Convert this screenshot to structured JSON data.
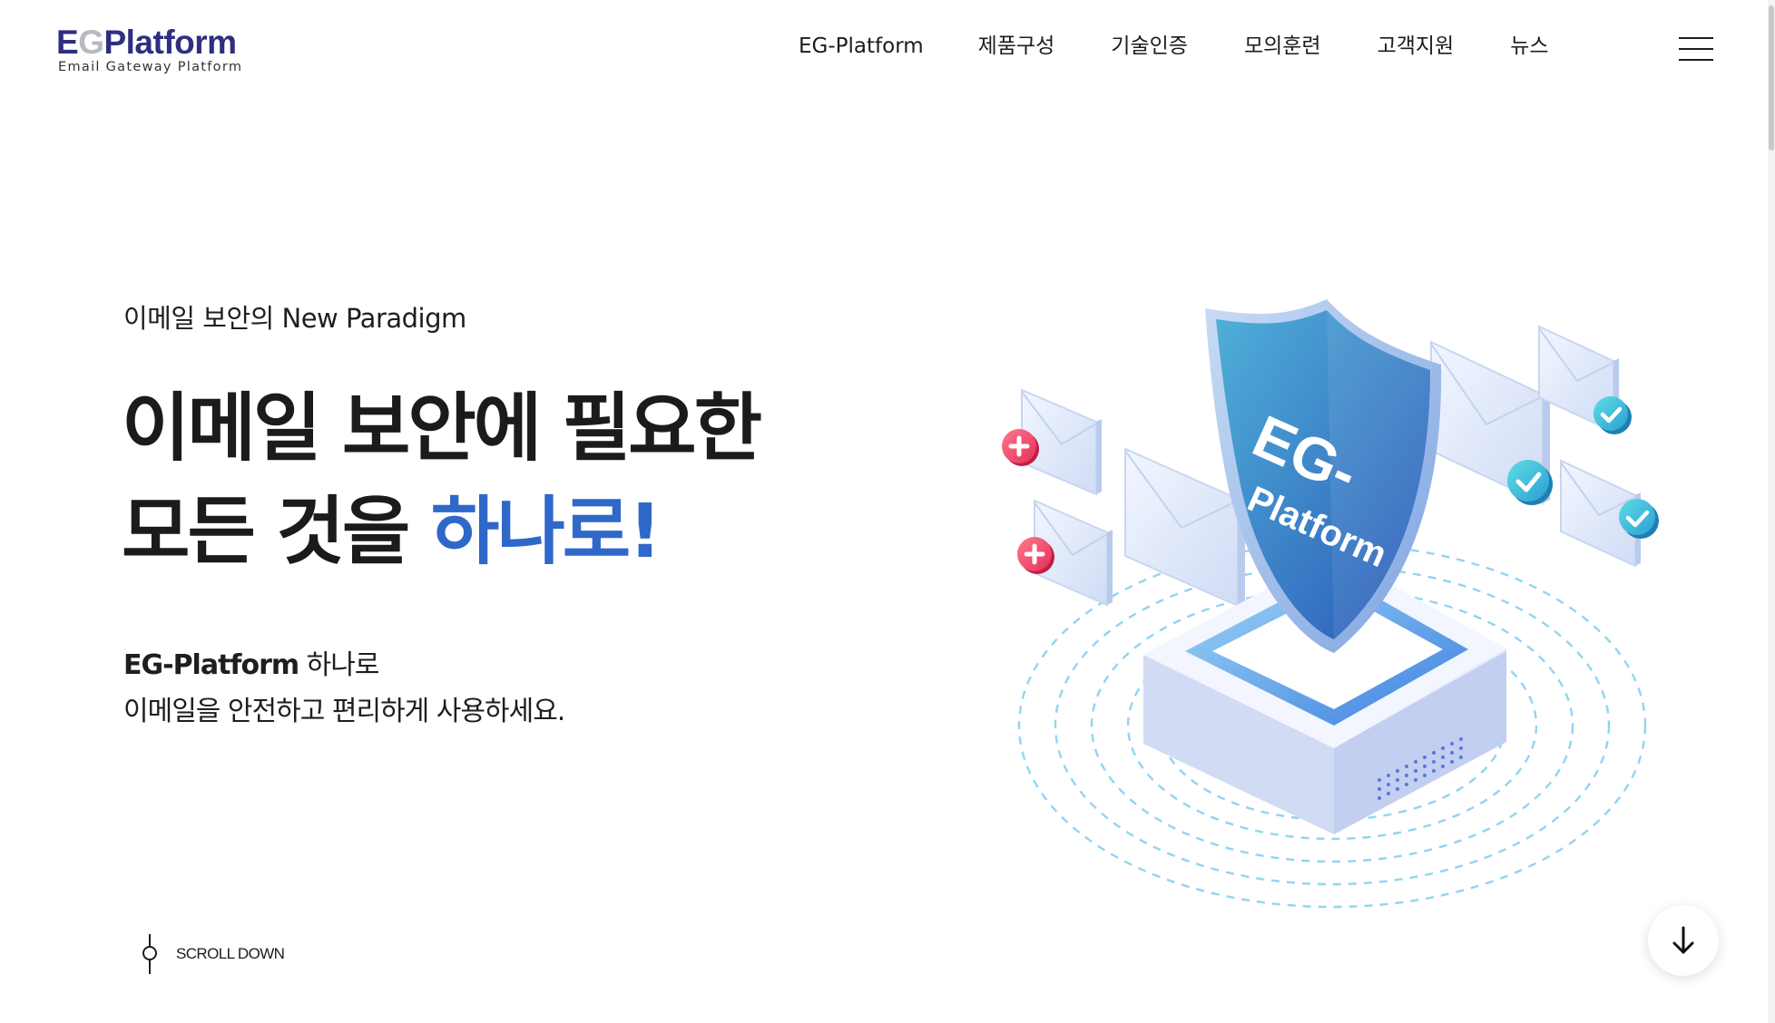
{
  "logo": {
    "main_e": "E",
    "main_g": "G",
    "main_rest": "Platform",
    "subtitle": "Email Gateway Platform"
  },
  "nav": {
    "items": [
      "EG-Platform",
      "제품구성",
      "기술인증",
      "모의훈련",
      "고객지원",
      "뉴스"
    ]
  },
  "menu_icon": "hamburger-menu-icon",
  "hero": {
    "tagline": "이메일 보안의 New Paradigm",
    "title_line1": "이메일 보안에 필요한",
    "title_line2_prefix": "모든 것을 ",
    "title_line2_accent": "하나로!",
    "desc_strong": "EG-Platform",
    "desc_line1_rest": " 하나로",
    "desc_line2": "이메일을 안전하고 편리하게 사용하세요."
  },
  "illustration": {
    "shield_line1": "EG-",
    "shield_line2": "Platform"
  },
  "scroll_down": {
    "label": "SCROLL DOWN"
  },
  "colors": {
    "accent": "#2f68c9",
    "logo_navy": "#2d2f80",
    "shield_blue": "#2a6fc6",
    "check_teal": "#3cc6d9",
    "error_pink": "#f0486b"
  }
}
